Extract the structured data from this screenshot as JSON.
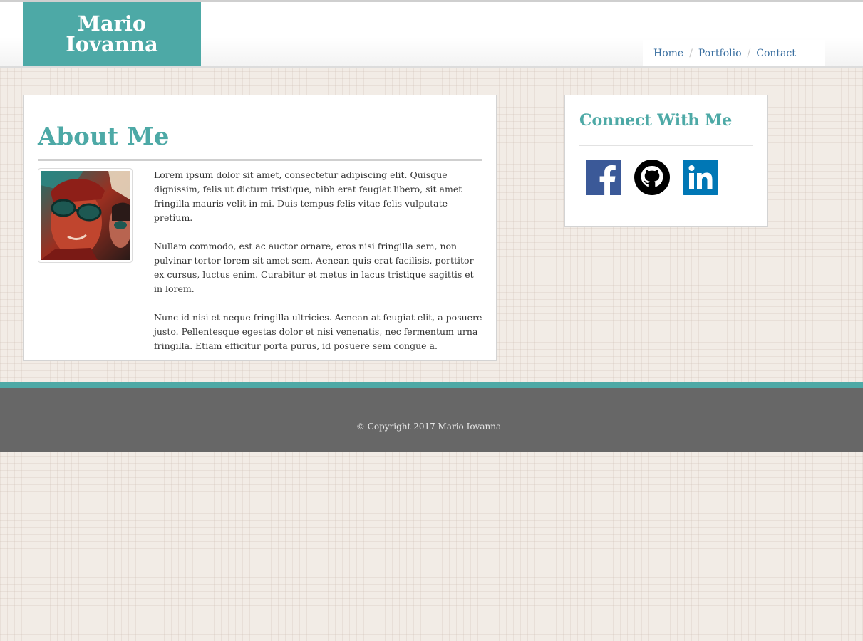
{
  "header": {
    "brand_line1": "Mario",
    "brand_line2": "Iovanna",
    "nav": [
      {
        "label": "Home"
      },
      {
        "label": "Portfolio"
      },
      {
        "label": "Contact"
      }
    ],
    "nav_separator": "/"
  },
  "about": {
    "title": "About Me",
    "paragraphs": [
      "Lorem ipsum dolor sit amet, consectetur adipiscing elit. Quisque dignissim, felis ut dictum tristique, nibh erat feugiat libero, sit amet fringilla mauris velit in mi. Duis tempus felis vitae felis vulputate pretium.",
      "Nullam commodo, est ac auctor ornare, eros nisi fringilla sem, non pulvinar tortor lorem sit amet sem. Aenean quis erat facilisis, porttitor ex cursus, luctus enim. Curabitur et metus in lacus tristique sagittis et in lorem.",
      "Nunc id nisi et neque fringilla ultricies. Aenean at feugiat elit, a posuere justo. Pellentesque egestas dolor et nisi venenatis, nec fermentum urna fringilla. Etiam efficitur porta purus, id posuere sem congue a."
    ]
  },
  "connect": {
    "title": "Connect With Me",
    "links": [
      {
        "icon": "facebook-icon",
        "color": "#3b5998"
      },
      {
        "icon": "github-icon",
        "color": "#000000"
      },
      {
        "icon": "linkedin-icon",
        "color": "#0077b5"
      }
    ]
  },
  "footer": {
    "copyright": "© Copyright 2017 Mario Iovanna"
  },
  "colors": {
    "accent": "#4da9a6",
    "footer": "#676767",
    "nav_link": "#3a6fa0"
  }
}
